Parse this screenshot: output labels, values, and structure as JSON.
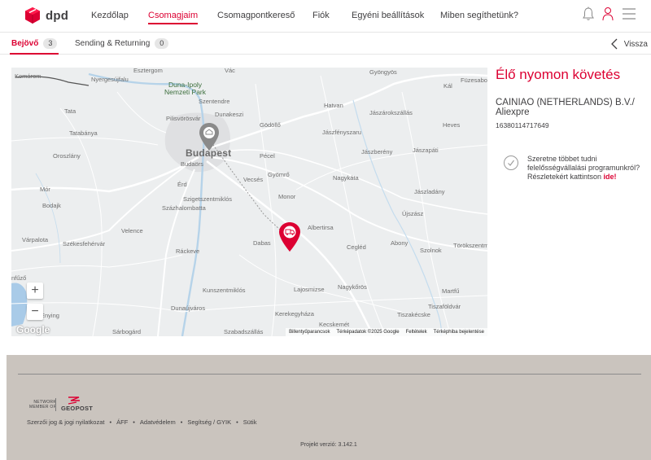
{
  "brand": {
    "name": "dpd",
    "accent": "#dc0032"
  },
  "nav": [
    {
      "label": "Kezdőlap",
      "active": false
    },
    {
      "label": "Csomagjaim",
      "active": true
    },
    {
      "label": "Csomagpontkereső",
      "active": false
    },
    {
      "label": "Fiók",
      "active": false
    },
    {
      "label": "Egyéni beállítások",
      "active": false
    },
    {
      "label": "Miben segíthetünk?",
      "active": false
    }
  ],
  "header_icons": [
    "bell-icon",
    "user-icon",
    "menu-icon"
  ],
  "tabs": [
    {
      "label": "Bejövő",
      "count": "3",
      "active": true
    },
    {
      "label": "Sending & Returning",
      "count": "0",
      "active": false
    }
  ],
  "back_label": "Vissza",
  "map": {
    "places": {
      "komarom": "Komárom",
      "esztergom": "Esztergom",
      "nyergesujfalu": "Nyergesújfalu",
      "vac": "Vác",
      "gyongyos": "Gyöngyös",
      "fuzesabony": "Füzesabo",
      "kal": "Kál",
      "park1": "Duna-Ipoly",
      "park2": "Nemzeti Park",
      "szentendre": "Szentendre",
      "tata": "Tata",
      "pilisvorosvar": "Pilisvörösvár",
      "dunakeszi": "Dunakeszi",
      "hatvan": "Hatvan",
      "jaszarokszallas": "Jászárokszállás",
      "tatabanya": "Tatabánya",
      "godollo": "Gödöllő",
      "jaszfenyszaru": "Jászfényszaru",
      "heves": "Heves",
      "budapest": "Budapest",
      "oroszlany": "Oroszlány",
      "budaors": "Budaörs",
      "pecel": "Pécel",
      "jaszbereny": "Jászberény",
      "jaszapati": "Jászapáti",
      "vecses": "Vecsés",
      "gyomro": "Gyömrő",
      "nagykata": "Nagykáta",
      "mor": "Mór",
      "erd": "Érd",
      "jaszladany": "Jászladány",
      "szigetszentmiklos": "Szigetszentmiklós",
      "monor": "Monor",
      "bodajk": "Bodajk",
      "szazhalombatta": "Százhalombatta",
      "ujszasz": "Újszász",
      "albertirsa": "Albertirsa",
      "velence": "Velence",
      "varpalota": "Várpalota",
      "szekesfehervar": "Székesfehérvár",
      "dabas": "Dabas",
      "cegled": "Cegléd",
      "abony": "Abony",
      "szolnok": "Szolnok",
      "torokszentmiklos": "Törökszentmiklós",
      "rackeve": "Ráckeve",
      "kunszentmiklos": "Kunszentmiklós",
      "lajosmizse": "Lajosmizse",
      "nagykoros": "Nagykőrös",
      "martfu": "Martfű",
      "nufzo": "nfűző",
      "enying": "Enying",
      "dunaujvaros": "Dunaújváros",
      "tiszafoldvar": "Tiszaföldvár",
      "kerekegyhaza": "Kerekegyháza",
      "tiszakecske": "Tiszakécske",
      "kecskemet": "Kecskemét",
      "sarbogard": "Sárbogárd",
      "szabadszallas": "Szabadszállás"
    },
    "zoom_in": "+",
    "zoom_out": "−",
    "google": "Google",
    "footer": [
      "Billentyűparancsok",
      "Térképadatok ©2025 Google",
      "Feltételek",
      "Térképhiba bejelentése"
    ]
  },
  "panel": {
    "title": "Élő nyomon követés",
    "sender": "CAINIAO (NETHERLANDS) B.V./ Aliexpre",
    "tracking_number": "16380114717649",
    "info_text": "Szeretne többet tudni felelősségvállalási programunkról? Részletekért kattintson ",
    "info_link": "ide!"
  },
  "footer": {
    "network_line1": "NETWORK",
    "network_line2": "MEMBER OF",
    "geopost": "GEOPOST",
    "links": [
      "Szerzői jog & jogi nyilatkozat",
      "ÁFF",
      "Adatvédelem",
      "Segítség / GYIK",
      "Sütik"
    ],
    "version": "Projekt verzió: 3.142.1"
  }
}
